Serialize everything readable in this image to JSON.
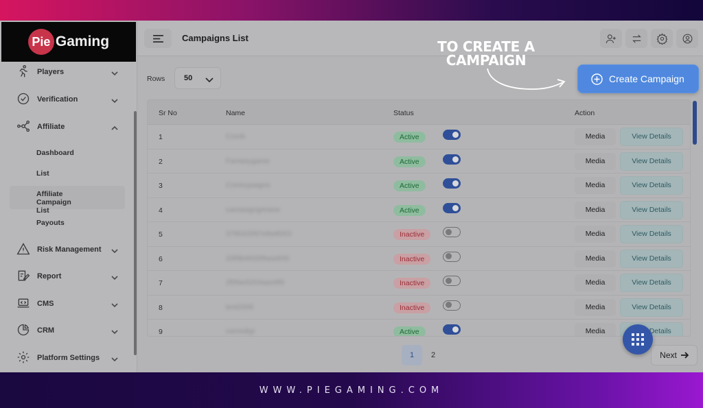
{
  "footer": {
    "url": "WWW.PIEGAMING.COM"
  },
  "brand": {
    "logo_mark": "Pie",
    "logo_rest": "Gaming"
  },
  "sidebar": {
    "items": [
      {
        "label": "Players",
        "icon": "running-person-icon"
      },
      {
        "label": "Verification",
        "icon": "check-circle-icon"
      },
      {
        "label": "Affiliate",
        "icon": "network-icon"
      },
      {
        "label": "Risk Management",
        "icon": "warning-triangle-icon"
      },
      {
        "label": "Report",
        "icon": "report-edit-icon"
      },
      {
        "label": "CMS",
        "icon": "laptop-code-icon"
      },
      {
        "label": "CRM",
        "icon": "pie-chart-icon"
      },
      {
        "label": "Platform Settings",
        "icon": "gear-icon"
      }
    ],
    "affiliate_sub": [
      "Dashboard",
      "List",
      "Affiliate Campaign List",
      "Payouts"
    ]
  },
  "header": {
    "title": "Campaigns List",
    "icons": [
      "add-user-icon",
      "swap-arrows-icon",
      "gear-icon",
      "user-circle-icon"
    ]
  },
  "toolbar": {
    "rows_label": "Rows",
    "rows_value": "50",
    "create_label": "Create Campaign"
  },
  "annotation": {
    "line1": "TO CREATE A",
    "line2": "CAMPAIGN"
  },
  "table": {
    "columns": [
      "Sr No",
      "Name",
      "Status",
      "Action"
    ],
    "media_label": "Media",
    "details_label": "View Details",
    "rows": [
      {
        "sr": "1",
        "name": "Comb",
        "status": "Active",
        "on": true
      },
      {
        "sr": "2",
        "name": "Fantasygame",
        "status": "Active",
        "on": true
      },
      {
        "sr": "3",
        "name": "Comeypaigns",
        "status": "Active",
        "on": true
      },
      {
        "sr": "4",
        "name": "camasigngrtoiew",
        "status": "Active",
        "on": true
      },
      {
        "sr": "5",
        "name": "379542097e8wtt553",
        "status": "Inactive",
        "on": false
      },
      {
        "sr": "6",
        "name": "33f984655f9wa4f45",
        "status": "Inactive",
        "on": false
      },
      {
        "sr": "7",
        "name": "2f0fae5254aao6f9",
        "status": "Inactive",
        "on": false
      },
      {
        "sr": "8",
        "name": "test2006",
        "status": "Inactive",
        "on": false
      },
      {
        "sr": "9",
        "name": "camsdigr",
        "status": "Active",
        "on": true
      }
    ]
  },
  "pagination": {
    "pages": [
      "1",
      "2"
    ],
    "current": "1",
    "next_label": "Next"
  },
  "colors": {
    "accent": "#4f88de",
    "active": "#1d6a36",
    "inactive": "#9c2b34"
  }
}
